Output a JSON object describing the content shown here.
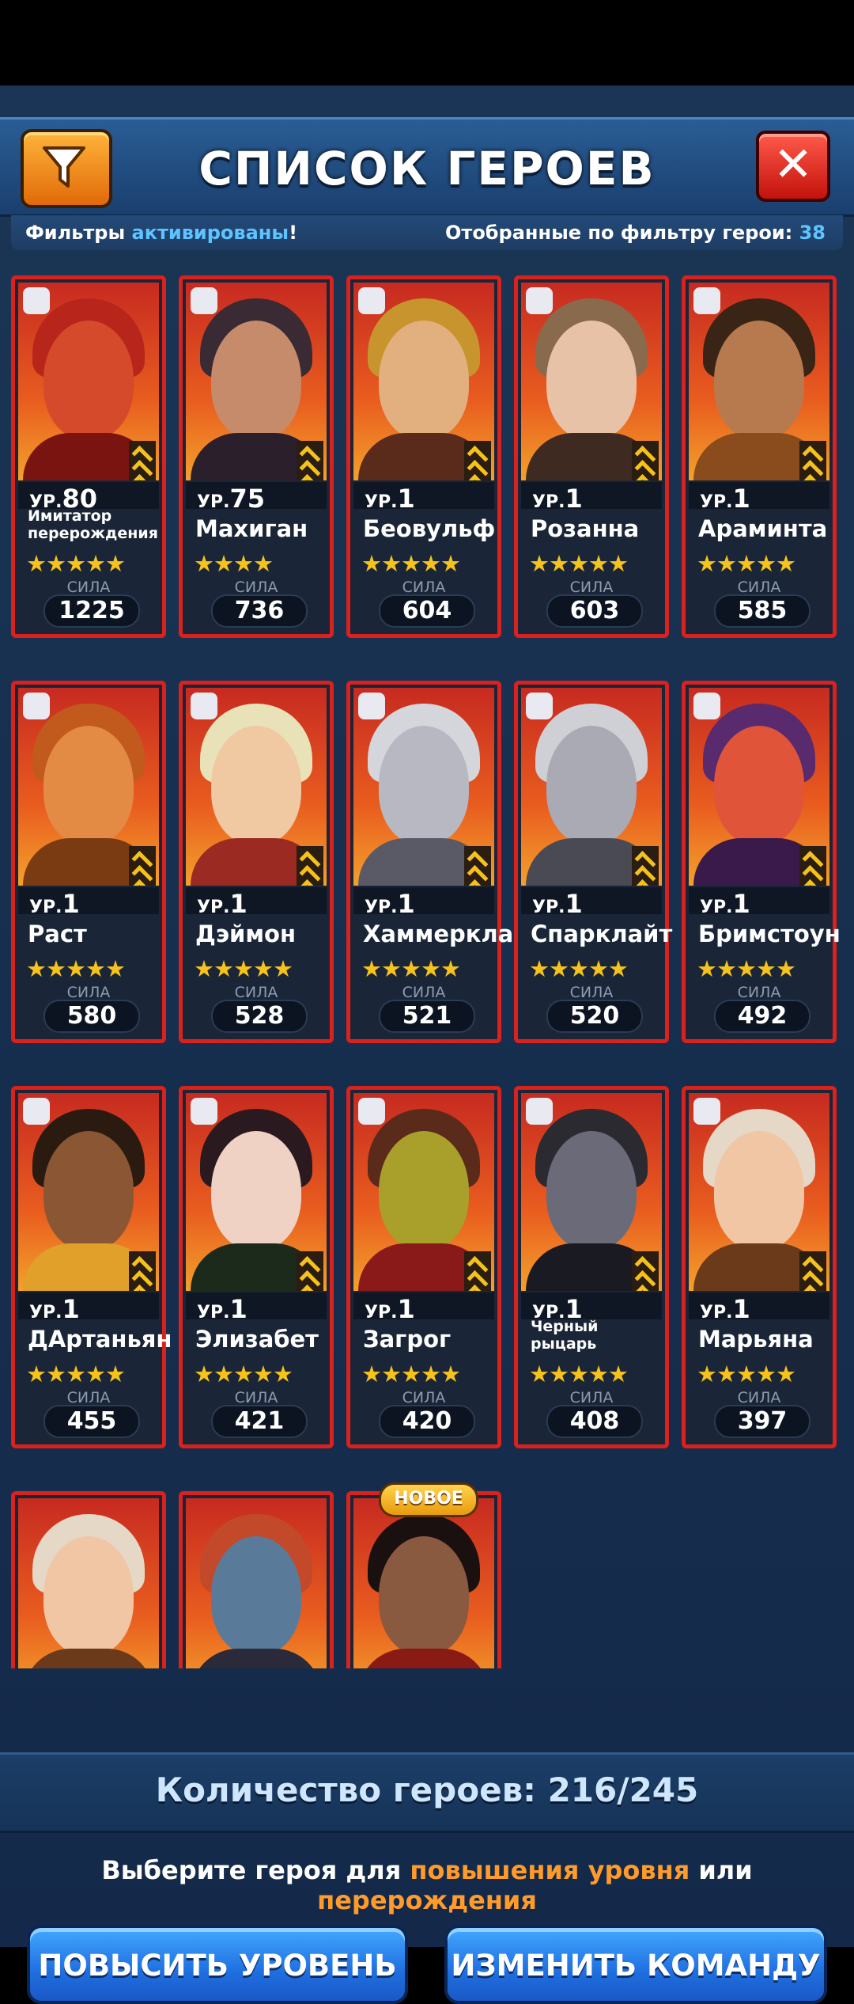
{
  "header": {
    "title": "СПИСОК ГЕРОЕВ",
    "filter_icon": "filter-funnel-icon",
    "close_icon": "close-x-icon"
  },
  "filter_bar": {
    "left_prefix": "Фильтры ",
    "left_accent": "активированы",
    "left_suffix": "!",
    "right_prefix": "Отобранные по фильтру герои: ",
    "right_count": "38"
  },
  "heroes": [
    {
      "level_prefix": "УР.",
      "level": "80",
      "name": "Имитатор перерождения",
      "power_label": "СИЛА",
      "power": "1225",
      "stars": "★★★★★",
      "small": true
    },
    {
      "level_prefix": "УР.",
      "level": "75",
      "name": "Махиган",
      "power_label": "СИЛА",
      "power": "736",
      "stars": "★★★★"
    },
    {
      "level_prefix": "УР.",
      "level": "1",
      "name": "Беовульф",
      "power_label": "СИЛА",
      "power": "604",
      "stars": "★★★★★"
    },
    {
      "level_prefix": "УР.",
      "level": "1",
      "name": "Розанна",
      "power_label": "СИЛА",
      "power": "603",
      "stars": "★★★★★"
    },
    {
      "level_prefix": "УР.",
      "level": "1",
      "name": "Араминта",
      "power_label": "СИЛА",
      "power": "585",
      "stars": "★★★★★"
    },
    {
      "level_prefix": "УР.",
      "level": "1",
      "name": "Раст",
      "power_label": "СИЛА",
      "power": "580",
      "stars": "★★★★★"
    },
    {
      "level_prefix": "УР.",
      "level": "1",
      "name": "Дэймон",
      "power_label": "СИЛА",
      "power": "528",
      "stars": "★★★★★"
    },
    {
      "level_prefix": "УР.",
      "level": "1",
      "name": "Хаммерклант",
      "power_label": "СИЛА",
      "power": "521",
      "stars": "★★★★★"
    },
    {
      "level_prefix": "УР.",
      "level": "1",
      "name": "Спарклайт",
      "power_label": "СИЛА",
      "power": "520",
      "stars": "★★★★★"
    },
    {
      "level_prefix": "УР.",
      "level": "1",
      "name": "Бримстоун",
      "power_label": "СИЛА",
      "power": "492",
      "stars": "★★★★★"
    },
    {
      "level_prefix": "УР.",
      "level": "1",
      "name": "ДАртаньян",
      "power_label": "СИЛА",
      "power": "455",
      "stars": "★★★★★"
    },
    {
      "level_prefix": "УР.",
      "level": "1",
      "name": "Элизабет",
      "power_label": "СИЛА",
      "power": "421",
      "stars": "★★★★★"
    },
    {
      "level_prefix": "УР.",
      "level": "1",
      "name": "Загрог",
      "power_label": "СИЛА",
      "power": "420",
      "stars": "★★★★★"
    },
    {
      "level_prefix": "УР.",
      "level": "1",
      "name": "Черный рыцарь",
      "power_label": "СИЛА",
      "power": "408",
      "stars": "★★★★★",
      "small": true
    },
    {
      "level_prefix": "УР.",
      "level": "1",
      "name": "Марьяна",
      "power_label": "СИЛА",
      "power": "397",
      "stars": "★★★★★"
    }
  ],
  "partial_row": {
    "new_badge": "НОВОЕ"
  },
  "footer": {
    "count_label": "Количество героев: 216/245",
    "hint_prefix": "Выберите героя для ",
    "hint_accent1": "повышения уровня",
    "hint_mid": " или ",
    "hint_accent2": "перерождения",
    "level_up_button": "ПОВЫСИТЬ УРОВЕНЬ",
    "change_team_button": "ИЗМЕНИТЬ КОМАНДУ"
  },
  "colors": {
    "accent_blue": "#5fc3ff",
    "accent_orange": "#ff9b2a",
    "card_border": "#d9211d",
    "star": "#f6c21c"
  }
}
